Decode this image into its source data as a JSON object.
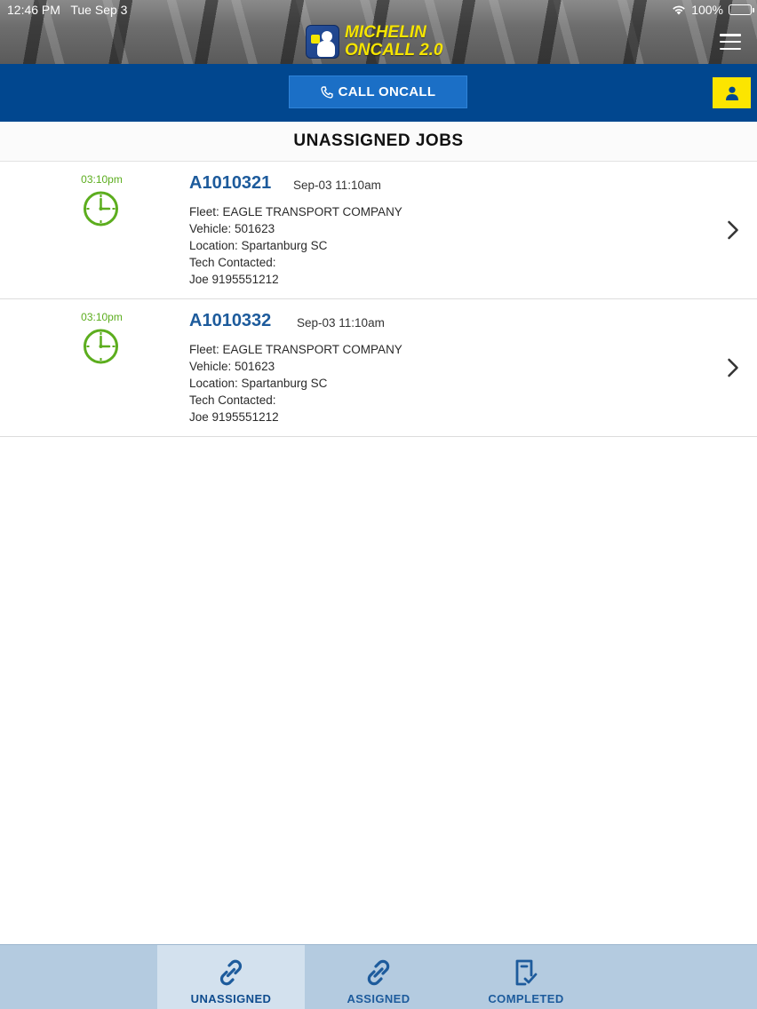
{
  "status_bar": {
    "time": "12:46 PM",
    "date": "Tue Sep 3",
    "battery": "100%"
  },
  "header": {
    "logo_line1": "MICHELIN",
    "logo_line2": "ONCALL 2.0",
    "accent_color": "#f5e400"
  },
  "actions": {
    "call_label": "CALL ONCALL"
  },
  "page": {
    "title": "UNASSIGNED JOBS"
  },
  "jobs": [
    {
      "time": "03:10pm",
      "id": "A1010321",
      "date": "Sep-03 11:10am",
      "fleet": "Fleet: EAGLE TRANSPORT COMPANY",
      "vehicle": "Vehicle: 501623",
      "location": "Location: Spartanburg SC",
      "tech_label": "Tech Contacted:",
      "tech": "Joe 9195551212"
    },
    {
      "time": "03:10pm",
      "id": "A1010332",
      "date": "Sep-03 11:10am",
      "fleet": "Fleet: EAGLE TRANSPORT COMPANY",
      "vehicle": "Vehicle: 501623",
      "location": "Location: Spartanburg SC",
      "tech_label": "Tech Contacted:",
      "tech": "Joe 9195551212"
    }
  ],
  "tabs": [
    {
      "label": "UNASSIGNED",
      "icon": "link-icon",
      "active": true
    },
    {
      "label": "ASSIGNED",
      "icon": "link-icon",
      "active": false
    },
    {
      "label": "COMPLETED",
      "icon": "checklist-icon",
      "active": false
    }
  ],
  "colors": {
    "brand_blue": "#01478f",
    "clock_green": "#5cad1e",
    "job_id_blue": "#1d5b9c",
    "tab_bar": "#b4cbe0"
  }
}
